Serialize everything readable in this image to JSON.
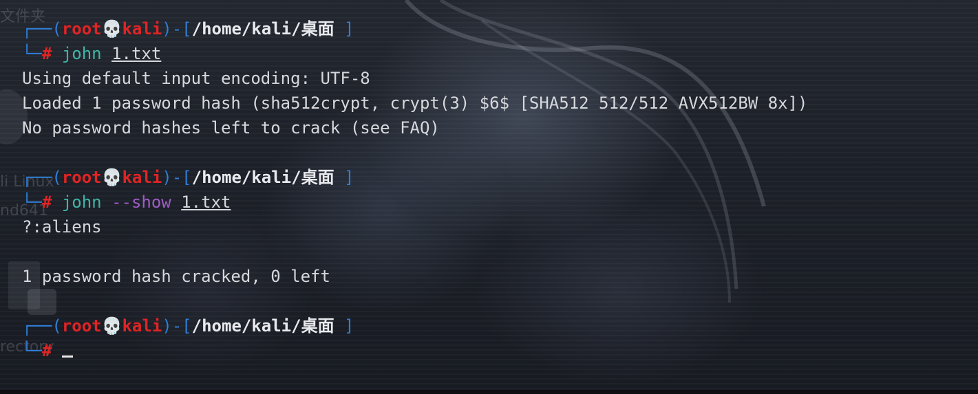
{
  "desktop": {
    "folder_label": "文件夹",
    "kali_label": "li Linux",
    "amd_label": "nd641",
    "directory_label": "rectory"
  },
  "prompt": {
    "frame_top": "┌──(",
    "user": "root",
    "skull": "💀",
    "host": "kali",
    "close_paren": ")-[",
    "path": "/home/kali/桌面",
    "close_bracket": "]",
    "frame_bottom": "└─",
    "symbol": "#"
  },
  "session": [
    {
      "command": "john",
      "option": "",
      "argument": "1.txt",
      "output": [
        "Using default input encoding: UTF-8",
        "Loaded 1 password hash (sha512crypt, crypt(3) $6$ [SHA512 512/512 AVX512BW 8x])",
        "No password hashes left to crack (see FAQ)"
      ]
    },
    {
      "command": "john",
      "option": "--show",
      "argument": "1.txt",
      "output": [
        "?:aliens",
        "",
        "1 password hash cracked, 0 left"
      ]
    }
  ],
  "colors": {
    "frame": "#2f7ed8",
    "user_host": "#e02424",
    "command": "#3fb6a8",
    "option": "#a05cc8",
    "text": "#d6d8dc"
  }
}
